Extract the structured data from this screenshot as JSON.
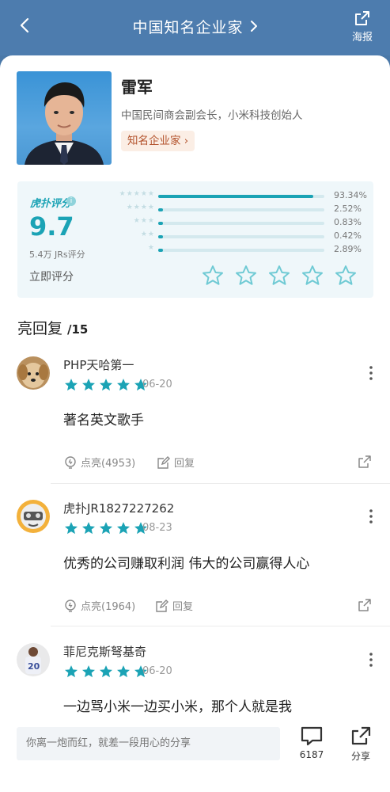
{
  "header": {
    "title": "中国知名企业家",
    "poster_label": "海报"
  },
  "profile": {
    "name": "雷军",
    "description": "中国民间商会副会长，小米科技创始人",
    "tag": "知名企业家"
  },
  "rating": {
    "brand": "虎扑评分",
    "score": "9.7",
    "count": "5.4万 JRs评分",
    "rate_now": "立即评分",
    "distribution": [
      {
        "stars": "★★★★★",
        "percent": "93.34%",
        "fraction": 0.9334
      },
      {
        "stars": "★★★★",
        "percent": "2.52%",
        "fraction": 0.0252
      },
      {
        "stars": "★★★",
        "percent": "0.83%",
        "fraction": 0.0083
      },
      {
        "stars": "★★",
        "percent": "0.42%",
        "fraction": 0.0042
      },
      {
        "stars": "★",
        "percent": "2.89%",
        "fraction": 0.0289
      }
    ]
  },
  "replies_section": {
    "title": "亮回复",
    "count": "/15"
  },
  "replies": [
    {
      "user": "PHP天哈第一",
      "date": "06-20",
      "content": "著名英文歌手",
      "likes": "点亮(4953)",
      "reply": "回复"
    },
    {
      "user": "虎扑JR1827227262",
      "date": "08-23",
      "content": "优秀的公司赚取利润 伟大的公司赢得人心",
      "likes": "点亮(1964)",
      "reply": "回复"
    },
    {
      "user": "菲尼克斯弩基奇",
      "date": "06-20",
      "content": "一边骂小米一边买小米，那个人就是我",
      "likes": "",
      "reply": ""
    }
  ],
  "bottom": {
    "placeholder": "你离一炮而红，就差一段用心的分享",
    "comment_count": "6187",
    "share_label": "分享"
  },
  "colors": {
    "accent": "#1ba3b5",
    "header": "#4d7cae",
    "tag_text": "#b3532d"
  }
}
